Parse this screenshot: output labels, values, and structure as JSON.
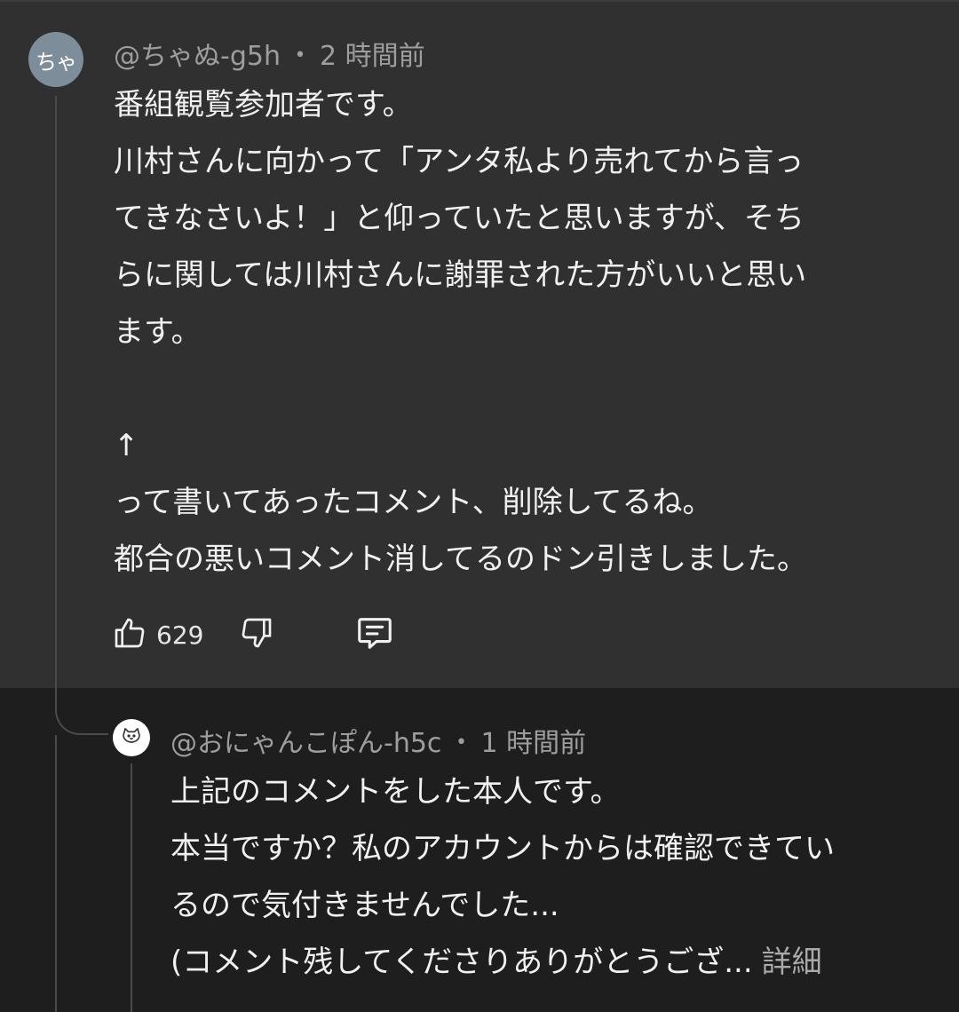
{
  "comment": {
    "avatar_text": "ちゃ",
    "author": "@ちゃぬ-g5h",
    "separator": "•",
    "time": "2 時間前",
    "lines": [
      "番組観覧参加者です。",
      "川村さんに向かって「アンタ私より売れてから言っ",
      "てきなさいよ！」と仰っていたと思いますが、そち",
      "らに関しては川村さんに謝罪された方がいいと思い",
      "ます。",
      "",
      "↑",
      "って書いてあったコメント、削除してるね。",
      "都合の悪いコメント消してるのドン引きしました。"
    ],
    "like_count": "629",
    "icons": {
      "like": "thumbs-up-icon",
      "dislike": "thumbs-down-icon",
      "reply": "comment-icon"
    }
  },
  "reply": {
    "avatar_icon": "cat-face-icon",
    "author": "@おにゃんこぽん-h5c",
    "separator": "•",
    "time": "1 時間前",
    "lines": [
      "上記のコメントをした本人です。",
      "本当ですか？私のアカウントからは確認できてい",
      "るので気付きませんでした...",
      "(コメント残してくださりありがとうござ..."
    ],
    "more_label": "詳細"
  },
  "colors": {
    "comment_bg": "#303030",
    "page_bg": "#1e1e1e",
    "text": "#f1f1f1",
    "meta": "#9e9e9e",
    "avatar": "#7d8d99"
  }
}
